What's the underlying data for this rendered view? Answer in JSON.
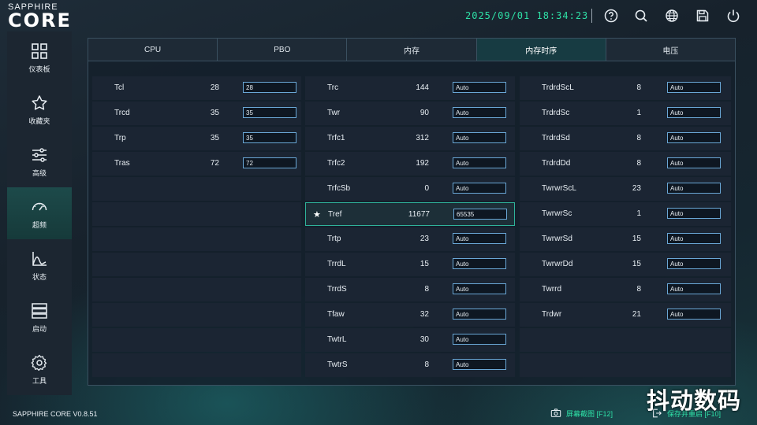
{
  "brand": {
    "top": "SAPPHIRE",
    "main": "CORE"
  },
  "datetime": "2025/09/01 18:34:23",
  "topbar_icons": [
    "help-icon",
    "search-icon",
    "globe-icon",
    "save-icon",
    "power-icon"
  ],
  "sidebar": {
    "items": [
      {
        "label": "仪表板",
        "icon": "dashboard-icon"
      },
      {
        "label": "收藏夹",
        "icon": "star-icon"
      },
      {
        "label": "高级",
        "icon": "sliders-icon"
      },
      {
        "label": "超频",
        "icon": "gauge-icon",
        "active": true
      },
      {
        "label": "状态",
        "icon": "chart-icon"
      },
      {
        "label": "启动",
        "icon": "server-icon"
      },
      {
        "label": "工具",
        "icon": "gear-icon"
      }
    ]
  },
  "tabs": [
    {
      "label": "CPU"
    },
    {
      "label": "PBO"
    },
    {
      "label": "内存"
    },
    {
      "label": "内存时序",
      "active": true
    },
    {
      "label": "电压"
    }
  ],
  "col1": [
    {
      "name": "Tcl",
      "value": "28",
      "input": "28"
    },
    {
      "name": "Trcd",
      "value": "35",
      "input": "35"
    },
    {
      "name": "Trp",
      "value": "35",
      "input": "35"
    },
    {
      "name": "Tras",
      "value": "72",
      "input": "72"
    }
  ],
  "col2": [
    {
      "name": "Trc",
      "value": "144",
      "input": "Auto"
    },
    {
      "name": "Twr",
      "value": "90",
      "input": "Auto"
    },
    {
      "name": "Trfc1",
      "value": "312",
      "input": "Auto"
    },
    {
      "name": "Trfc2",
      "value": "192",
      "input": "Auto"
    },
    {
      "name": "TrfcSb",
      "value": "0",
      "input": "Auto"
    },
    {
      "name": "Tref",
      "value": "11677",
      "input": "65535",
      "favorite": true
    },
    {
      "name": "Trtp",
      "value": "23",
      "input": "Auto"
    },
    {
      "name": "TrrdL",
      "value": "15",
      "input": "Auto"
    },
    {
      "name": "TrrdS",
      "value": "8",
      "input": "Auto"
    },
    {
      "name": "Tfaw",
      "value": "32",
      "input": "Auto"
    },
    {
      "name": "TwtrL",
      "value": "30",
      "input": "Auto"
    },
    {
      "name": "TwtrS",
      "value": "8",
      "input": "Auto"
    }
  ],
  "col3": [
    {
      "name": "TrdrdScL",
      "value": "8",
      "input": "Auto"
    },
    {
      "name": "TrdrdSc",
      "value": "1",
      "input": "Auto"
    },
    {
      "name": "TrdrdSd",
      "value": "8",
      "input": "Auto"
    },
    {
      "name": "TrdrdDd",
      "value": "8",
      "input": "Auto"
    },
    {
      "name": "TwrwrScL",
      "value": "23",
      "input": "Auto"
    },
    {
      "name": "TwrwrSc",
      "value": "1",
      "input": "Auto"
    },
    {
      "name": "TwrwrSd",
      "value": "15",
      "input": "Auto"
    },
    {
      "name": "TwrwrDd",
      "value": "15",
      "input": "Auto"
    },
    {
      "name": "Twrrd",
      "value": "8",
      "input": "Auto"
    },
    {
      "name": "Trdwr",
      "value": "21",
      "input": "Auto"
    }
  ],
  "footer": {
    "version": "SAPPHIRE CORE V0.8.51",
    "screenshot": "屏幕截图",
    "screenshot_key": "[F12]",
    "save_restart": "保存并重启",
    "save_restart_key": "[F10]"
  },
  "watermark": "抖动数码",
  "colors": {
    "accent": "#2ee0a6",
    "input_border": "#6aa7d6",
    "active_tab": "#173b42"
  }
}
